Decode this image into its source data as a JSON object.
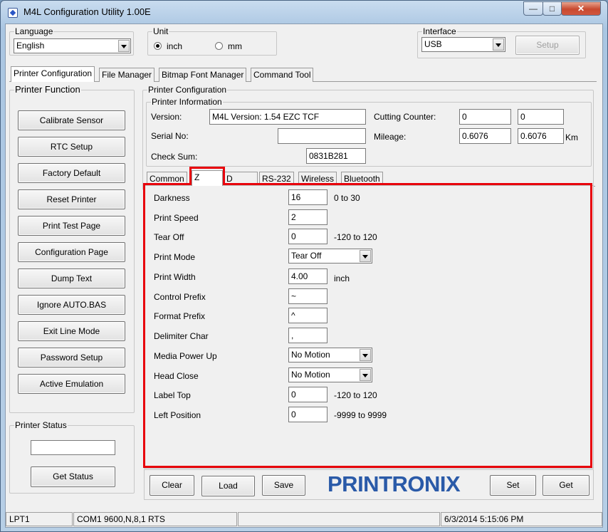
{
  "window": {
    "title": "M4L Configuration Utility  1.00E",
    "minimize": "—",
    "maximize": "□",
    "close": "✕"
  },
  "top": {
    "language_label": "Language",
    "language_value": "English",
    "unit_label": "Unit",
    "unit_inch": "inch",
    "unit_mm": "mm",
    "unit_selected": "inch",
    "interface_label": "Interface",
    "interface_value": "USB",
    "setup_button": "Setup"
  },
  "main_tabs": [
    "Printer Configuration",
    "File Manager",
    "Bitmap Font Manager",
    "Command Tool"
  ],
  "printer_function": {
    "title": "Printer Function",
    "buttons": [
      "Calibrate Sensor",
      "RTC Setup",
      "Factory Default",
      "Reset Printer",
      "Print Test Page",
      "Configuration Page",
      "Dump Text",
      "Ignore AUTO.BAS",
      "Exit Line Mode",
      "Password Setup",
      "Active Emulation"
    ]
  },
  "printer_status": {
    "title": "Printer Status",
    "value": "",
    "get_status": "Get Status"
  },
  "printer_configuration": {
    "title": "Printer Configuration",
    "info_title": "Printer Information",
    "version_label": "Version:",
    "version_value": "M4L Version: 1.54 EZC TCF",
    "serial_label": "Serial No:",
    "serial_value": "",
    "checksum_label": "Check Sum:",
    "checksum_value": "0831B281",
    "cutting_label": "Cutting Counter:",
    "cutting_1": "0",
    "cutting_2": "0",
    "mileage_label": "Mileage:",
    "mileage_1": "0.6076",
    "mileage_2": "0.6076",
    "mileage_unit": "Km"
  },
  "sub_tabs": [
    "Common",
    "Z",
    "D",
    "RS-232",
    "Wireless",
    "Bluetooth"
  ],
  "z_settings": [
    {
      "label": "Darkness",
      "value": "16",
      "hint": "0 to 30",
      "kind": "text"
    },
    {
      "label": "Print Speed",
      "value": "2",
      "hint": "",
      "kind": "text"
    },
    {
      "label": "Tear Off",
      "value": "0",
      "hint": "-120 to 120",
      "kind": "text"
    },
    {
      "label": "Print Mode",
      "value": "Tear Off",
      "hint": "",
      "kind": "select"
    },
    {
      "label": "Print Width",
      "value": "4.00",
      "hint": "inch",
      "kind": "text"
    },
    {
      "label": "Control Prefix",
      "value": "~",
      "hint": "",
      "kind": "text"
    },
    {
      "label": "Format Prefix",
      "value": "^",
      "hint": "",
      "kind": "text"
    },
    {
      "label": "Delimiter Char",
      "value": ",",
      "hint": "",
      "kind": "text"
    },
    {
      "label": "Media Power Up",
      "value": "No Motion",
      "hint": "",
      "kind": "select"
    },
    {
      "label": "Head Close",
      "value": "No Motion",
      "hint": "",
      "kind": "select"
    },
    {
      "label": "Label Top",
      "value": "0",
      "hint": "-120 to 120",
      "kind": "text"
    },
    {
      "label": "Left Position",
      "value": "0",
      "hint": "-9999 to 9999",
      "kind": "text"
    }
  ],
  "bottom_buttons": {
    "clear": "Clear",
    "load": "Load",
    "save": "Save",
    "set": "Set",
    "get": "Get"
  },
  "logo_text": "PRINTRONIX",
  "status_bar": {
    "port": "LPT1",
    "com": "COM1 9600,N,8,1 RTS",
    "empty": "",
    "datetime": "6/3/2014 5:15:06 PM"
  },
  "colors": {
    "highlight": "#e8000b",
    "logo": "#2a5aa8"
  }
}
